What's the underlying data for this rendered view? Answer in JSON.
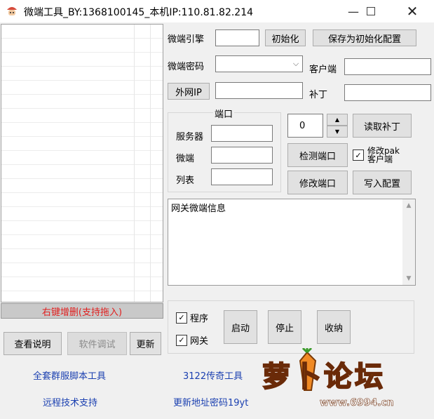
{
  "window": {
    "title": "微端工具_BY:1368100145_本机IP:110.81.82.214",
    "minimize_icon": "minimize-icon",
    "maximize_icon": "maximize-icon",
    "close_icon": "close-icon"
  },
  "list": {
    "footer_label": "右键增删(支持拖入)"
  },
  "bottom_left": {
    "view_help_label": "查看说明",
    "software_debug_label": "软件调试",
    "refresh_label": "更新"
  },
  "links": {
    "full_set_tools": "全套群服脚本工具",
    "remote_support": "远程技术支持",
    "tools_3122": "3122传奇工具",
    "update_address": "更新地址密码19yt"
  },
  "engine": {
    "label": "微端引擎",
    "value": "",
    "init_button": "初始化",
    "save_init_button": "保存为初始化配置"
  },
  "password": {
    "label": "微端密码",
    "value": ""
  },
  "client": {
    "label": "客户端",
    "value": ""
  },
  "external_ip": {
    "button": "外网IP",
    "value": ""
  },
  "patch": {
    "label": "补丁",
    "value": ""
  },
  "ports": {
    "group_title": "端口",
    "server_label": "服务器",
    "server_value": "",
    "micro_label": "微端",
    "micro_value": "",
    "list_label": "列表",
    "list_value": ""
  },
  "spinner": {
    "value": "0"
  },
  "actions": {
    "read_patch": "读取补丁",
    "check_port": "检测端口",
    "modify_port": "修改端口",
    "write_config": "写入配置",
    "modify_pak_line1": "修改pak",
    "modify_pak_line2": "客户端",
    "modify_pak_checked": true
  },
  "info": {
    "text": "网关微端信息"
  },
  "run": {
    "program_label": "程序",
    "program_checked": true,
    "gateway_label": "网关",
    "gateway_checked": true,
    "start_label": "启动",
    "stop_label": "停止",
    "tray_label": "收纳"
  },
  "watermark": {
    "brand": "萝卜论坛",
    "url": "www.6994.cn"
  }
}
